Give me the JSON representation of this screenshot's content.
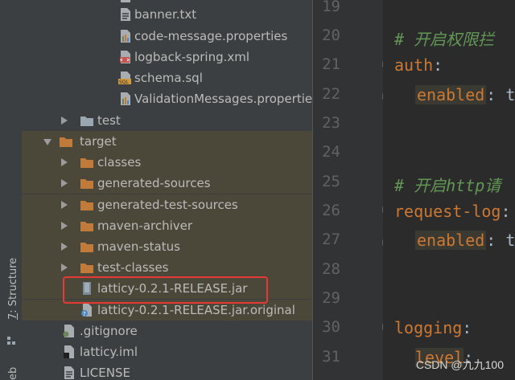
{
  "sidebar_strip": {
    "structure_label_mnemonic": "7",
    "structure_label_rest": ": Structure",
    "partial_label": "eb"
  },
  "tree": {
    "items": [
      {
        "label": "banner.txt",
        "icon": "text-file-icon"
      },
      {
        "label": "code-message.properties",
        "icon": "properties-file-icon"
      },
      {
        "label": "logback-spring.xml",
        "icon": "xml-file-icon"
      },
      {
        "label": "schema.sql",
        "icon": "sql-file-icon"
      },
      {
        "label": "ValidationMessages.properties",
        "icon": "properties-file-icon"
      },
      {
        "label": "test",
        "icon": "folder-icon"
      },
      {
        "label": "target",
        "icon": "folder-icon"
      },
      {
        "label": "classes",
        "icon": "folder-icon"
      },
      {
        "label": "generated-sources",
        "icon": "folder-icon"
      },
      {
        "label": "generated-test-sources",
        "icon": "folder-icon"
      },
      {
        "label": "maven-archiver",
        "icon": "folder-icon"
      },
      {
        "label": "maven-status",
        "icon": "folder-icon"
      },
      {
        "label": "test-classes",
        "icon": "folder-icon"
      },
      {
        "label": "latticy-0.2.1-RELEASE.jar",
        "icon": "jar-file-icon"
      },
      {
        "label": "latticy-0.2.1-RELEASE.jar.original",
        "icon": "unknown-file-icon"
      },
      {
        "label": ".gitignore",
        "icon": "gitignore-file-icon"
      },
      {
        "label": "latticy.iml",
        "icon": "iml-file-icon"
      },
      {
        "label": "LICENSE",
        "icon": "text-file-icon"
      }
    ]
  },
  "gutter": {
    "line_numbers": [
      "19",
      "20",
      "21",
      "22",
      "23",
      "24",
      "25",
      "26",
      "27",
      "28",
      "29",
      "30",
      "31"
    ]
  },
  "editor": {
    "line20": "# 开启权限拦",
    "line21_key": "auth",
    "line21_colon": ":",
    "line22_key": "enabled",
    "line22_rest": ": t",
    "line25": "# 开启http请",
    "line26_key": "request-log",
    "line26_colon": ":",
    "line27_key": "enabled",
    "line27_rest": ": t",
    "line30_key": "logging",
    "line30_colon": ":",
    "line31_key": "level",
    "line31_colon": ":"
  },
  "watermark": "CSDN @九九100",
  "colors": {
    "highlight_box": "#e53935",
    "selection_bg": "#4b4739",
    "folder": "#c07a3a",
    "comment": "#629755",
    "key": "#cc7832"
  }
}
